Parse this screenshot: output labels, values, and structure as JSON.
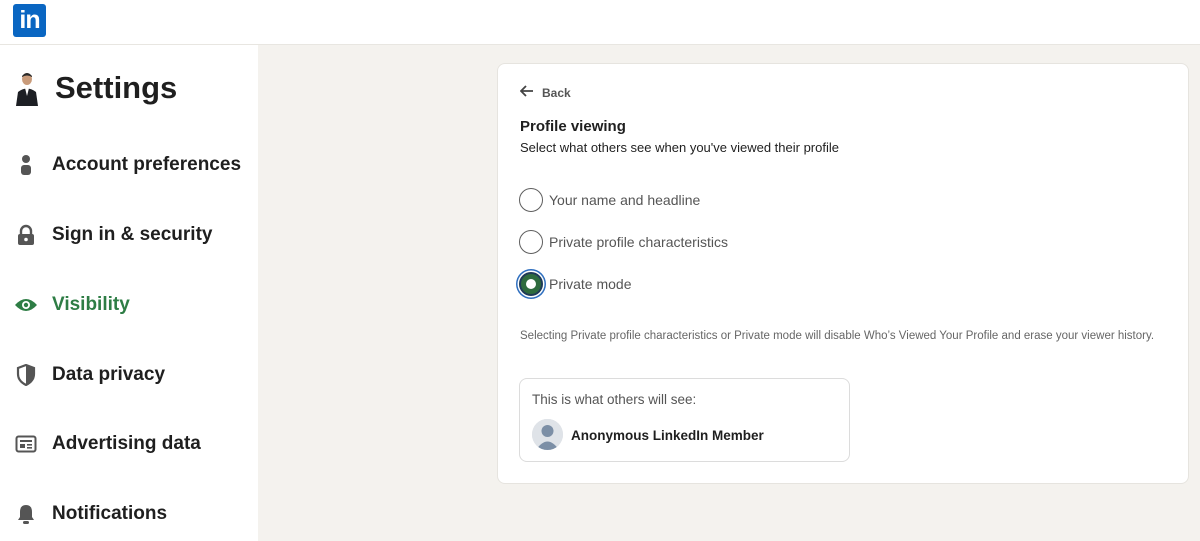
{
  "app": {
    "logo_text": "in",
    "brand_color": "#0a66c2"
  },
  "sidebar": {
    "title": "Settings",
    "items": [
      {
        "label": "Account preferences",
        "icon": "person-icon",
        "active": false
      },
      {
        "label": "Sign in & security",
        "icon": "lock-icon",
        "active": false
      },
      {
        "label": "Visibility",
        "icon": "eye-icon",
        "active": true
      },
      {
        "label": "Data privacy",
        "icon": "shield-icon",
        "active": false
      },
      {
        "label": "Advertising data",
        "icon": "newspaper-icon",
        "active": false
      },
      {
        "label": "Notifications",
        "icon": "bell-icon",
        "active": false
      }
    ],
    "active_color": "#2e7d45"
  },
  "card": {
    "back_label": "Back",
    "title": "Profile viewing",
    "subtitle": "Select what others see when you've viewed their profile",
    "options": [
      {
        "label": "Your name and headline",
        "selected": false
      },
      {
        "label": "Private profile characteristics",
        "selected": false
      },
      {
        "label": "Private mode",
        "selected": true
      }
    ],
    "note": "Selecting Private profile characteristics or Private mode will disable Who’s Viewed Your Profile and erase your viewer history.",
    "preview": {
      "title": "This is what others will see:",
      "name": "Anonymous LinkedIn Member"
    }
  }
}
